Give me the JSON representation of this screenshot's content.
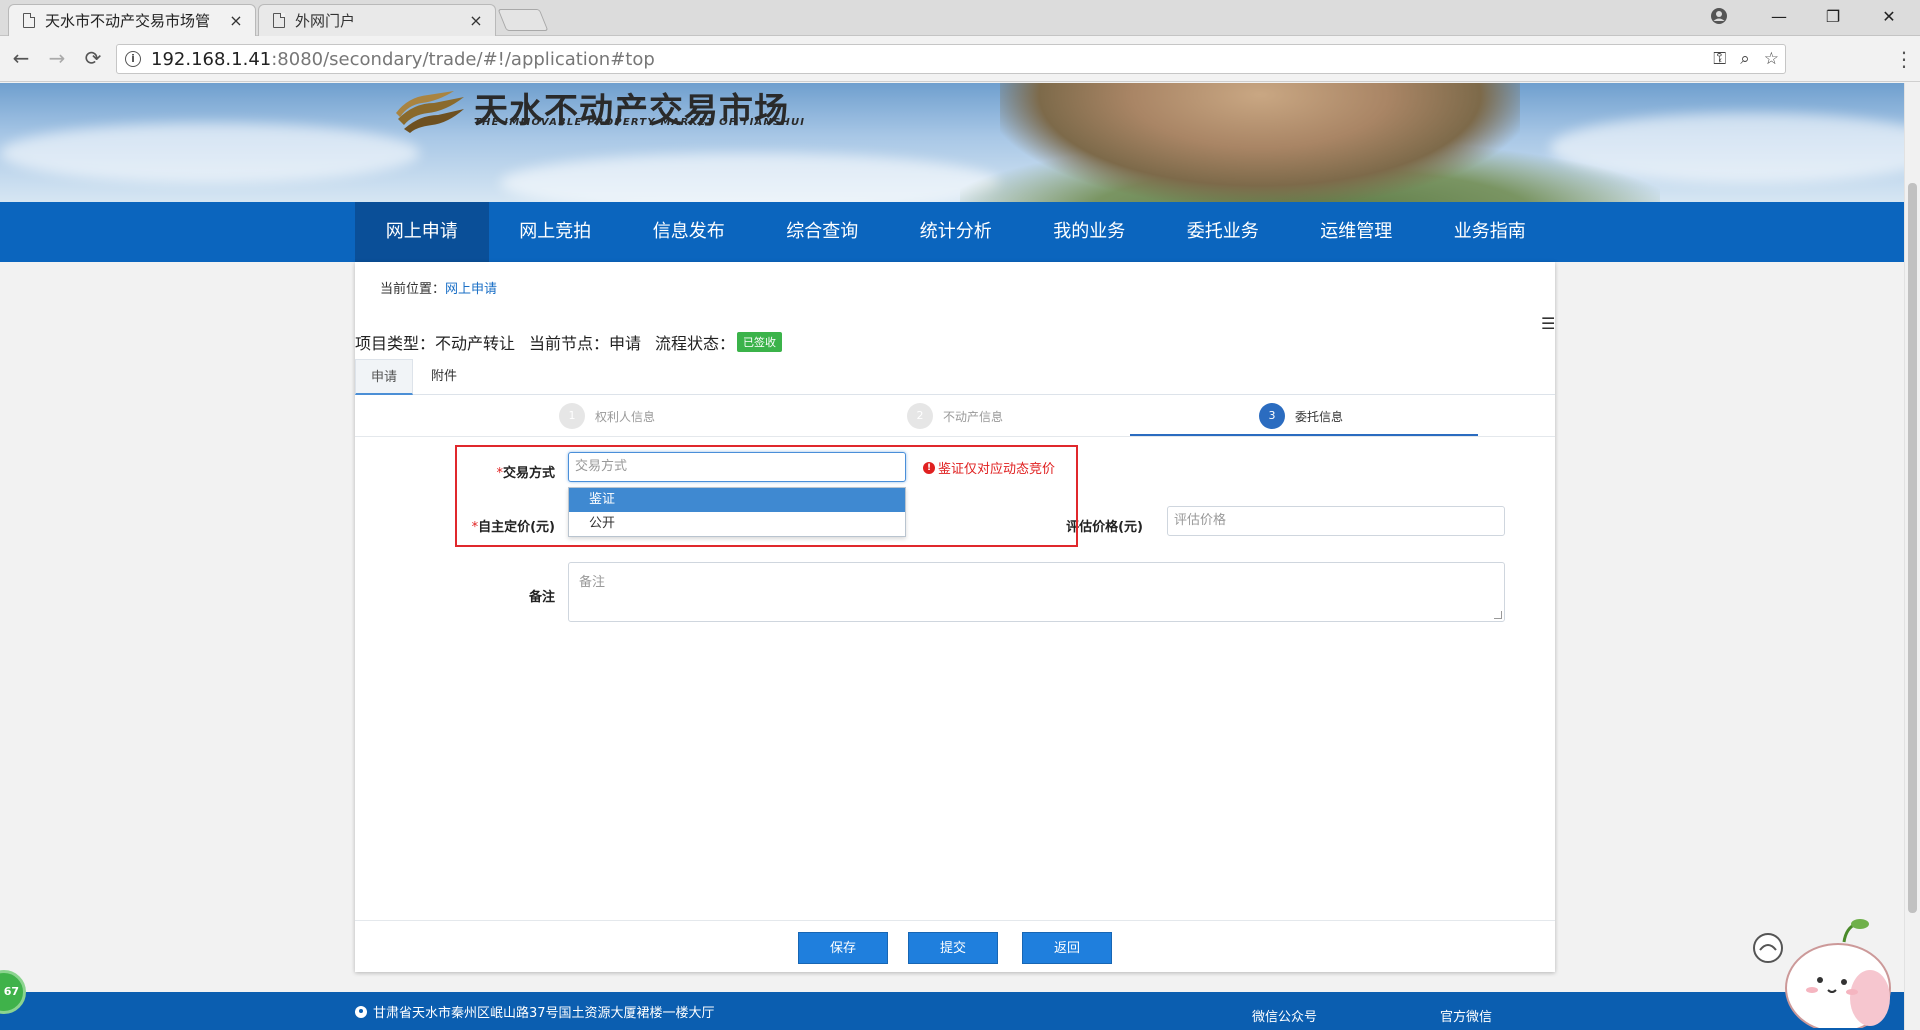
{
  "browser": {
    "tabs": [
      {
        "title": "天水市不动产交易市场管",
        "close": "×"
      },
      {
        "title": "外网门户",
        "close": "×"
      }
    ],
    "url_host": "192.168.1.41",
    "url_rest": ":8080/secondary/trade/#!/application#top",
    "window_controls": {
      "minimize": "—",
      "restore": "❐",
      "close": "✕"
    }
  },
  "header": {
    "logo_cn": "天水不动产交易市场",
    "logo_en": "THE IMMOVABLE PROPERTY MARKET OF TIANSHUI"
  },
  "nav": {
    "items": [
      "网上申请",
      "网上竞拍",
      "信息发布",
      "综合查询",
      "统计分析",
      "我的业务",
      "委托业务",
      "运维管理",
      "业务指南"
    ],
    "active_index": 0
  },
  "breadcrumb": {
    "prefix": "当前位置：",
    "current": "网上申请"
  },
  "project": {
    "type_label": "项目类型：不动产转让",
    "node_label": "当前节点：申请",
    "status_label": "流程状态：",
    "status_badge": "已签收"
  },
  "subtabs": [
    "申请",
    "附件"
  ],
  "steps": [
    {
      "num": "1",
      "label": "权利人信息"
    },
    {
      "num": "2",
      "label": "不动产信息"
    },
    {
      "num": "3",
      "label": "委托信息"
    }
  ],
  "form": {
    "required_mark": "*",
    "trade_mode_label": "交易方式",
    "trade_mode_placeholder": "交易方式",
    "trade_mode_options": [
      "鉴证",
      "公开"
    ],
    "trade_mode_hint": "鉴证仅对应动态竞价",
    "self_price_label": "自主定价(元)",
    "assess_price_label": "评估价格(元)",
    "assess_price_placeholder": "评估价格",
    "remark_label": "备注",
    "remark_placeholder": "备注"
  },
  "buttons": {
    "save": "保存",
    "submit": "提交",
    "back": "返回"
  },
  "footer": {
    "address": "甘肃省天水市秦州区岷山路37号国土资源大厦裙楼一楼大厅",
    "wechat_public": "微信公众号",
    "official_wechat": "官方微信"
  },
  "widget_counter": "67",
  "colors": {
    "nav_blue": "#0b65be",
    "nav_active": "#0a4f98",
    "button_blue": "#1f7fdd",
    "status_green": "#3bb34a",
    "error_red": "#e02020"
  }
}
